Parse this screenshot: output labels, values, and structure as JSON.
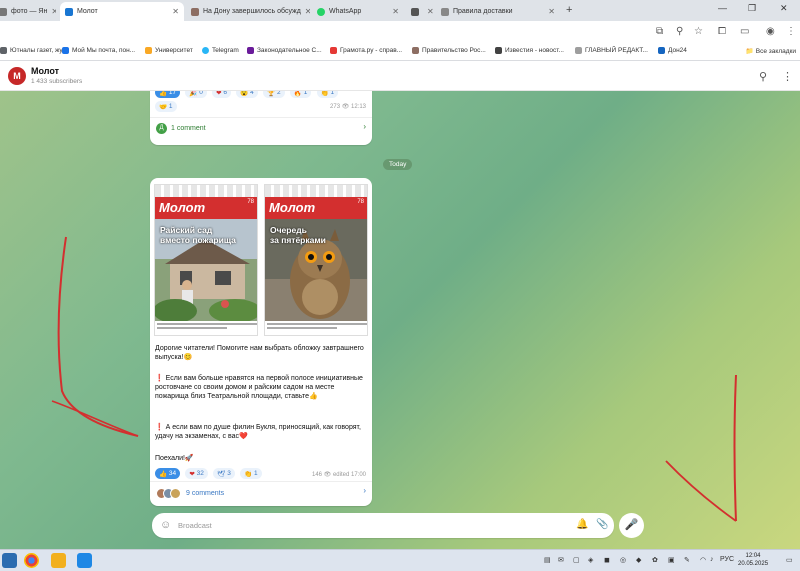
{
  "browser": {
    "tabs": [
      {
        "title": "фото — Ян",
        "color": "#777777"
      },
      {
        "title": "Молот",
        "color": "#1976d2"
      },
      {
        "title": "На Дону завершилось обсужд",
        "color": "#8d6e63"
      },
      {
        "title": "WhatsApp",
        "color": "#25d366"
      },
      {
        "title": "",
        "color": "#555555"
      },
      {
        "title": "Правила доставки",
        "color": "#888888"
      }
    ],
    "bookmarks": [
      {
        "label": "Ютналы газет, жу...",
        "color": "#5f6368"
      },
      {
        "label": "Мой Мы почта, пон...",
        "color": "#1a73e8"
      },
      {
        "label": "Университет",
        "color": "#f9a825"
      },
      {
        "label": "Telegram",
        "color": "#29b6f6"
      },
      {
        "label": "Законодательное С...",
        "color": "#6a1b9a"
      },
      {
        "label": "Грамота.ру - справ...",
        "color": "#e53935"
      },
      {
        "label": "Правительство Рос...",
        "color": "#8d6e63"
      },
      {
        "label": "Известия - новост...",
        "color": "#424242"
      },
      {
        "label": "ГЛАВНЫЙ РЕДАКТ...",
        "color": "#9e9e9e"
      },
      {
        "label": "Дон24",
        "color": "#1565c0"
      }
    ],
    "bookmarks_all": "Все закладки"
  },
  "channel": {
    "avatar_letter": "М",
    "name": "Молот",
    "subscribers": "1 433 subscribers"
  },
  "previous_post": {
    "reactions": [
      {
        "icon": "👍",
        "count": "17",
        "mine": true
      },
      {
        "icon": "🎉",
        "count": "0",
        "mine": false
      },
      {
        "icon": "❤",
        "count": "6",
        "mine": false
      },
      {
        "icon": "😮",
        "count": "4",
        "mine": false
      },
      {
        "icon": "🏆",
        "count": "2",
        "mine": false
      },
      {
        "icon": "🔥",
        "count": "1",
        "mine": false
      },
      {
        "icon": "👏",
        "count": "1",
        "mine": false
      }
    ],
    "extra_reaction": {
      "icon": "🤝",
      "count": "1"
    },
    "meta": "273 👁 12:13",
    "comments": "1 comment"
  },
  "date_divider": "Today",
  "post": {
    "covers": [
      {
        "masthead": "Молот",
        "issue": "78",
        "headline_1": "Райский сад",
        "headline_2": "вместо пожарища"
      },
      {
        "masthead": "Молот",
        "issue": "78",
        "headline_1": "Очередь",
        "headline_2": "за пятёрками"
      }
    ],
    "p1": "Дорогие читатели! Помогите нам выбрать обложку завтрашнего выпуска!😊",
    "p2": "Если вам больше нравятся на первой полосе инициативные ростовчане со своим домом и райским садом на месте пожарища близ Театральной площади, ставьте👍",
    "p3": "А если вам по душе филин Букля, приносящий, как говорят, удачу на экзаменах, с вас❤️",
    "p4": "Поехали!🚀",
    "mark": "❗",
    "reactions": [
      {
        "icon": "👍",
        "count": "34",
        "mine": true
      },
      {
        "icon": "❤",
        "count": "32",
        "mine": false
      },
      {
        "icon": "🕊",
        "count": "3",
        "mine": false
      },
      {
        "icon": "👏",
        "count": "1",
        "mine": false
      }
    ],
    "meta": "146 👁 edited 17:00",
    "comments": "9 comments"
  },
  "composer": {
    "placeholder": "Broadcast"
  },
  "taskbar": {
    "lang": "РУС",
    "time": "12:04",
    "date": "20.05.2025"
  },
  "colors": {
    "accent": "#3a8ee6",
    "brand_red": "#d32f2f",
    "arrow_red": "#d32f2f"
  }
}
